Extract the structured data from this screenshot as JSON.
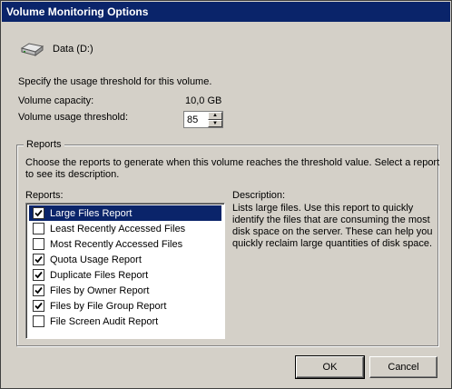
{
  "window": {
    "title": "Volume Monitoring Options"
  },
  "volume": {
    "icon": "drive-icon",
    "name": "Data (D:)",
    "instruction": "Specify the usage threshold for this volume.",
    "capacity_label": "Volume capacity:",
    "capacity_value": "10,0 GB",
    "threshold_label": "Volume usage threshold:",
    "threshold_value": "85"
  },
  "reports": {
    "group_title": "Reports",
    "instruction_line1": "Choose the reports to generate when this volume reaches the threshold value. Select a report",
    "instruction_line2": "to see its description.",
    "list_label": "Reports:",
    "items": [
      {
        "label": "Large Files Report",
        "checked": true,
        "selected": true
      },
      {
        "label": "Least Recently Accessed Files",
        "checked": false,
        "selected": false
      },
      {
        "label": "Most Recently Accessed Files",
        "checked": false,
        "selected": false
      },
      {
        "label": "Quota Usage Report",
        "checked": true,
        "selected": false
      },
      {
        "label": "Duplicate Files Report",
        "checked": true,
        "selected": false
      },
      {
        "label": "Files by Owner Report",
        "checked": true,
        "selected": false
      },
      {
        "label": "Files by File Group Report",
        "checked": true,
        "selected": false
      },
      {
        "label": "File Screen Audit Report",
        "checked": false,
        "selected": false
      }
    ],
    "description_label": "Description:",
    "description_text": "Lists large files. Use this report to quickly identify the files that are consuming the most disk space on the server. These can help you quickly reclaim large quantities of disk space."
  },
  "buttons": {
    "ok": "OK",
    "cancel": "Cancel"
  },
  "colors": {
    "titlebar": "#0a246a",
    "dialog_bg": "#d4d0c8",
    "selection": "#0a246a"
  }
}
